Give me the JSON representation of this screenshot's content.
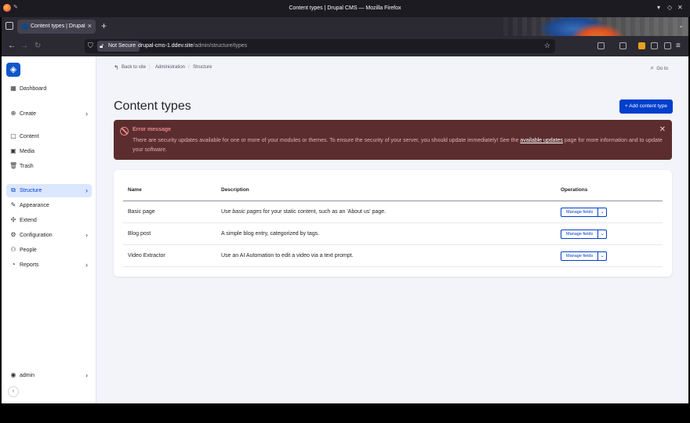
{
  "window": {
    "title": "Content types | Drupal CMS — Mozilla Firefox"
  },
  "browser": {
    "tab_label": "Content types | Drupal CMS",
    "security_label": "Not Secure",
    "url_host": "drupal-cms-1.ddev.site",
    "url_path": "/admin/structure/types"
  },
  "sidebar": {
    "items": [
      {
        "label": "Dashboard",
        "icon": "dashboard-icon"
      },
      {
        "label": "Create",
        "icon": "plus-circle-icon"
      },
      {
        "label": "Content",
        "icon": "document-icon"
      },
      {
        "label": "Media",
        "icon": "image-icon"
      },
      {
        "label": "Trash",
        "icon": "trash-icon"
      },
      {
        "label": "Structure",
        "icon": "structure-icon"
      },
      {
        "label": "Appearance",
        "icon": "brush-icon"
      },
      {
        "label": "Extend",
        "icon": "puzzle-icon"
      },
      {
        "label": "Configuration",
        "icon": "gear-icon"
      },
      {
        "label": "People",
        "icon": "people-icon"
      },
      {
        "label": "Reports",
        "icon": "chart-icon"
      }
    ],
    "user": "admin"
  },
  "topbar": {
    "back": "Back to site",
    "crumb1": "Administration",
    "crumb2": "Structure",
    "goto": "Go to"
  },
  "page": {
    "title": "Content types",
    "add_button": "+ Add content type"
  },
  "error": {
    "title": "Error message",
    "text_before": "There are security updates available for one or more of your modules or themes. To ensure the security of your server, you should update immediately! See the ",
    "link": "available updates",
    "text_after": " page for more information and to update your software."
  },
  "table": {
    "headers": {
      "name": "Name",
      "description": "Description",
      "operations": "Operations"
    },
    "rows": [
      {
        "name": "Basic page",
        "desc_pre": "Use ",
        "desc_em": "basic pages",
        "desc_post": " for your static content, such as an 'About us' page.",
        "op": "Manage fields"
      },
      {
        "name": "Blog post",
        "desc_pre": "A simple blog entry, categorized by tags.",
        "desc_em": "",
        "desc_post": "",
        "op": "Manage fields"
      },
      {
        "name": "Video Extractor",
        "desc_pre": "Use an AI Automation to edit a video via a text prompt.",
        "desc_em": "",
        "desc_post": "",
        "op": "Manage fields"
      }
    ]
  },
  "colors": {
    "accent": "#003ecc",
    "error_bg": "#5b2d2f",
    "active_nav": "#dbe7ff"
  }
}
